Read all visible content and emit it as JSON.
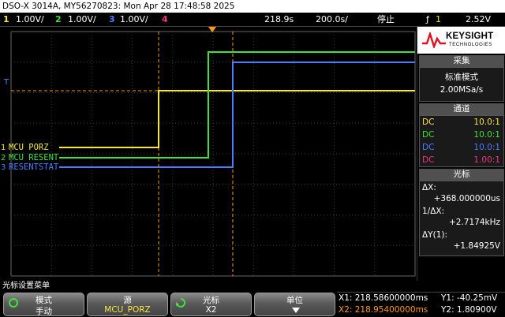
{
  "title": "DSO-X 3014A, MY56270823: Mon Apr 28 17:48:58 2025",
  "channels": [
    {
      "num": "1",
      "scale": "1.00V/",
      "color": "#f5e642"
    },
    {
      "num": "2",
      "scale": "1.00V/",
      "color": "#3ee23b"
    },
    {
      "num": "3",
      "scale": "1.00V/",
      "color": "#4a7cff"
    },
    {
      "num": "4",
      "scale": "",
      "color": "#f0308a"
    }
  ],
  "timebase": {
    "delay": "218.9s",
    "scale": "200.0s/"
  },
  "run_state": "停止",
  "trigger": {
    "channel": "1",
    "level": "2.52V"
  },
  "labels": {
    "ch1": "MCU PORZ",
    "ch2": "MCU RESENT",
    "ch3": "RESENTSTAT"
  },
  "markers": {
    "ch1": "1",
    "ch2": "2",
    "ch3": "3"
  },
  "logo": {
    "name": "KEYSIGHT",
    "sub": "TECHNOLOGIES"
  },
  "acquire": {
    "header": "采集",
    "mode": "标准模式",
    "rate": "2.00MSa/s"
  },
  "channel_panel": {
    "header": "通道",
    "rows": [
      {
        "coupling": "DC",
        "probe": "10.0:1",
        "color": "#f5e642"
      },
      {
        "coupling": "DC",
        "probe": "10.0:1",
        "color": "#3ee23b"
      },
      {
        "coupling": "DC",
        "probe": "10.0:1",
        "color": "#4a7cff"
      },
      {
        "coupling": "DC",
        "probe": "1.00:1",
        "color": "#f0308a"
      }
    ]
  },
  "cursor_panel": {
    "header": "光标",
    "dx_label": "ΔX:",
    "dx_value": "+368.000000us",
    "inv_dx_label": "1/ΔX:",
    "inv_dx_value": "+2.7174kHz",
    "dy_label": "ΔY(1):",
    "dy_value": "+1.84925V"
  },
  "menu_title": "光标设置菜单",
  "softkeys": [
    {
      "label": "模式",
      "value": "手动"
    },
    {
      "label": "源",
      "value": "MCU_PORZ"
    },
    {
      "label": "光标",
      "value": "X2"
    },
    {
      "label": "单位",
      "value": ""
    }
  ],
  "readout": {
    "x1": "X1: 218.58600000ms",
    "y1": "Y1: -40.25mV",
    "x2": "X2: 218.95400000ms",
    "y2": "Y2: 1.80900V"
  },
  "colors": {
    "x_cursor": "#ff9a1a",
    "grid": "#3a3a3a",
    "grid_border": "#666"
  }
}
